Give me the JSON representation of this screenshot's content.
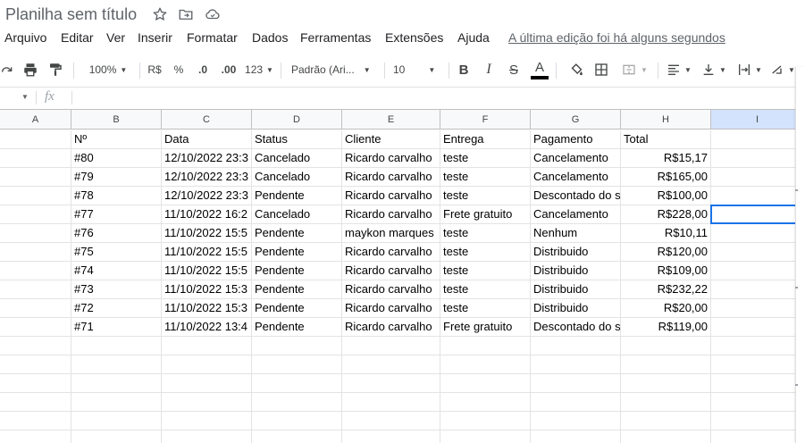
{
  "title": "Planilha sem título",
  "title_icons": [
    "star-icon",
    "move-to-folder-icon",
    "cloud-saved-icon"
  ],
  "menu": [
    "Arquivo",
    "Editar",
    "Ver",
    "Inserir",
    "Formatar",
    "Dados",
    "Ferramentas",
    "Extensões",
    "Ajuda"
  ],
  "last_edit": "A última edição foi há alguns segundos",
  "toolbar": {
    "zoom": "100%",
    "currency": "R$",
    "percent": "%",
    "decrease_decimal": ".0",
    "increase_decimal": ".00",
    "more_formats": "123",
    "font": "Padrão (Ari...",
    "font_size": "10",
    "bold": "B",
    "italic": "I",
    "strike": "S",
    "text_color": "A"
  },
  "formula": {
    "fx": "fx",
    "value": ""
  },
  "columns": [
    "A",
    "B",
    "C",
    "D",
    "E",
    "F",
    "G",
    "H",
    "I"
  ],
  "table": {
    "header": [
      "Nº",
      "Data",
      "Status",
      "Cliente",
      "Entrega",
      "Pagamento",
      "Total"
    ],
    "rows": [
      [
        "#80",
        "12/10/2022 23:3",
        "Cancelado",
        "Ricardo carvalho",
        "teste",
        "Cancelamento",
        "R$15,17"
      ],
      [
        "#79",
        "12/10/2022 23:3",
        "Cancelado",
        "Ricardo carvalho",
        "teste",
        "Cancelamento",
        "R$165,00"
      ],
      [
        "#78",
        "12/10/2022 23:3",
        "Pendente",
        "Ricardo carvalho",
        "teste",
        "Descontado do s",
        "R$100,00"
      ],
      [
        "#77",
        "11/10/2022 16:2",
        "Cancelado",
        "Ricardo carvalho",
        "Frete gratuito",
        "Cancelamento",
        "R$228,00"
      ],
      [
        "#76",
        "11/10/2022 15:5",
        "Pendente",
        "maykon marques",
        "teste",
        "Nenhum",
        "R$10,11"
      ],
      [
        "#75",
        "11/10/2022 15:5",
        "Pendente",
        "Ricardo carvalho",
        "teste",
        "Distribuido",
        "R$120,00"
      ],
      [
        "#74",
        "11/10/2022 15:5",
        "Pendente",
        "Ricardo carvalho",
        "teste",
        "Distribuido",
        "R$109,00"
      ],
      [
        "#73",
        "11/10/2022 15:3",
        "Pendente",
        "Ricardo carvalho",
        "teste",
        "Distribuido",
        "R$232,22"
      ],
      [
        "#72",
        "11/10/2022 15:3",
        "Pendente",
        "Ricardo carvalho",
        "teste",
        "Distribuido",
        "R$20,00"
      ],
      [
        "#71",
        "11/10/2022 13:4",
        "Pendente",
        "Ricardo carvalho",
        "Frete gratuito",
        "Descontado do s",
        "R$119,00"
      ]
    ]
  },
  "colors": {
    "accent": "#1a73e8",
    "header_bg": "#f8f9fa",
    "grid_line": "#e2e3e3"
  }
}
